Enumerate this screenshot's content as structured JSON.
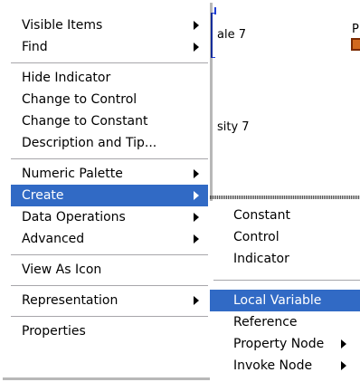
{
  "background": {
    "text_scale": "ale 7",
    "text_density": "sity 7",
    "text_p": "P"
  },
  "context_menu": {
    "groups": [
      [
        {
          "label": "Visible Items",
          "submenu": true
        },
        {
          "label": "Find",
          "submenu": true
        }
      ],
      [
        {
          "label": "Hide Indicator",
          "submenu": false
        },
        {
          "label": "Change to Control",
          "submenu": false
        },
        {
          "label": "Change to Constant",
          "submenu": false
        },
        {
          "label": "Description and Tip...",
          "submenu": false
        }
      ],
      [
        {
          "label": "Numeric Palette",
          "submenu": true
        },
        {
          "label": "Create",
          "submenu": true,
          "highlighted": true
        },
        {
          "label": "Data Operations",
          "submenu": true
        },
        {
          "label": "Advanced",
          "submenu": true
        }
      ],
      [
        {
          "label": "View As Icon",
          "submenu": false
        }
      ],
      [
        {
          "label": "Representation",
          "submenu": true
        }
      ],
      [
        {
          "label": "Properties",
          "submenu": false
        }
      ]
    ]
  },
  "create_submenu": {
    "groups": [
      [
        {
          "label": "Constant",
          "submenu": false
        },
        {
          "label": "Control",
          "submenu": false
        },
        {
          "label": "Indicator",
          "submenu": false
        }
      ],
      [
        {
          "label": "Local Variable",
          "submenu": false,
          "highlighted": true
        },
        {
          "label": "Reference",
          "submenu": false
        },
        {
          "label": "Property Node",
          "submenu": true
        },
        {
          "label": "Invoke Node",
          "submenu": true
        }
      ]
    ]
  },
  "colors": {
    "highlight": "#316ac5",
    "separator": "#a7a6aa",
    "menu_background": "#ffffff"
  }
}
